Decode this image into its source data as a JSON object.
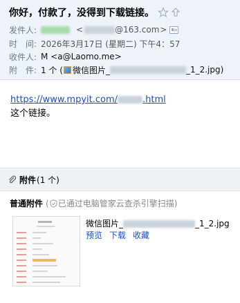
{
  "subject": "你好，付款了，没得到下载链接。",
  "meta": {
    "from_label": "发件人:",
    "from_domain": "@163.com",
    "time_label": "时　间:",
    "time_value": "2026年3月17日 (星期二) 下午4：57",
    "to_label": "收件人:",
    "to_value": "M <a@Laomo.me>",
    "att_label": "附　件:",
    "att_count_text": "1 个 (",
    "att_name_prefix": "微信图片_",
    "att_name_suffix": "_1_2.jpg",
    "att_close": ")"
  },
  "body": {
    "link_prefix": "https://www.mpyit.com/",
    "link_suffix": ".html",
    "line2": "这个链接。"
  },
  "attachments": {
    "title": "附件",
    "count": "(1 个)",
    "normal_title": "普通附件",
    "scan_note": "已通过电脑管家云查杀引擎扫描)",
    "scan_open": "(",
    "file_prefix": "微信图片_",
    "file_suffix": "_1_2.jpg",
    "preview": "预览",
    "download": "下载",
    "favorite": "收藏"
  },
  "colors": {
    "header_bg": "#eef3fa",
    "link": "#1a4cc6",
    "label": "#6b7b8c"
  },
  "icons": [
    "star-icon",
    "share-up-icon",
    "contact-card-icon",
    "image-thumb-icon",
    "paperclip-icon",
    "shield-icon"
  ]
}
